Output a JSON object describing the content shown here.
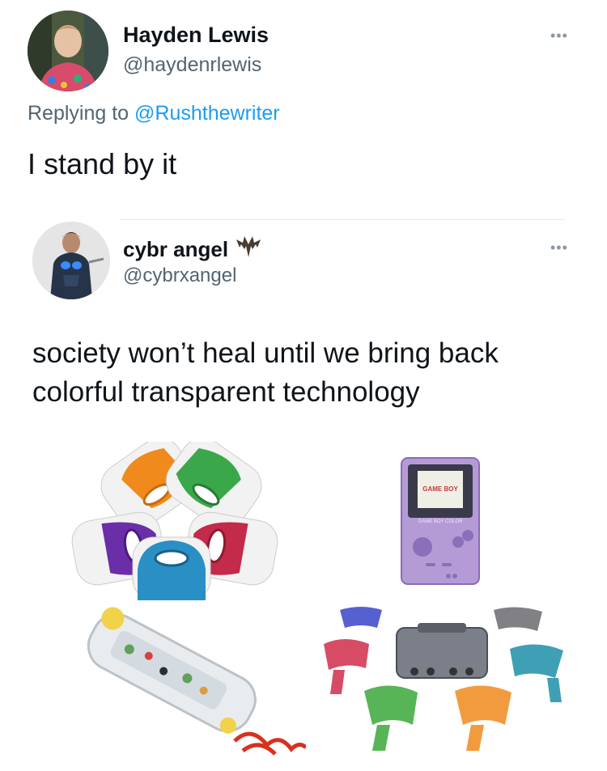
{
  "tweet": {
    "author_name": "Hayden Lewis",
    "author_handle": "@haydenrlewis",
    "replying_prefix": "Replying to",
    "replying_to": "@Rushthewriter",
    "text": "I stand by it",
    "more_icon": "more-horizontal-icon"
  },
  "quoted_tweet": {
    "author_name": "cybr angel",
    "author_handle": "@cybrxangel",
    "name_emoji": "bat-icon",
    "text_line1": "society won’t heal until we bring back",
    "text_line2": "colorful transparent technology",
    "more_icon": "more-horizontal-icon"
  },
  "media": {
    "gameboy_logo": "GAME BOY",
    "gameboy_sub": "GAME BOY COLOR"
  },
  "colors": {
    "accent_link": "#1d9bf0",
    "text_primary": "#0f1419",
    "text_secondary": "#536471"
  }
}
